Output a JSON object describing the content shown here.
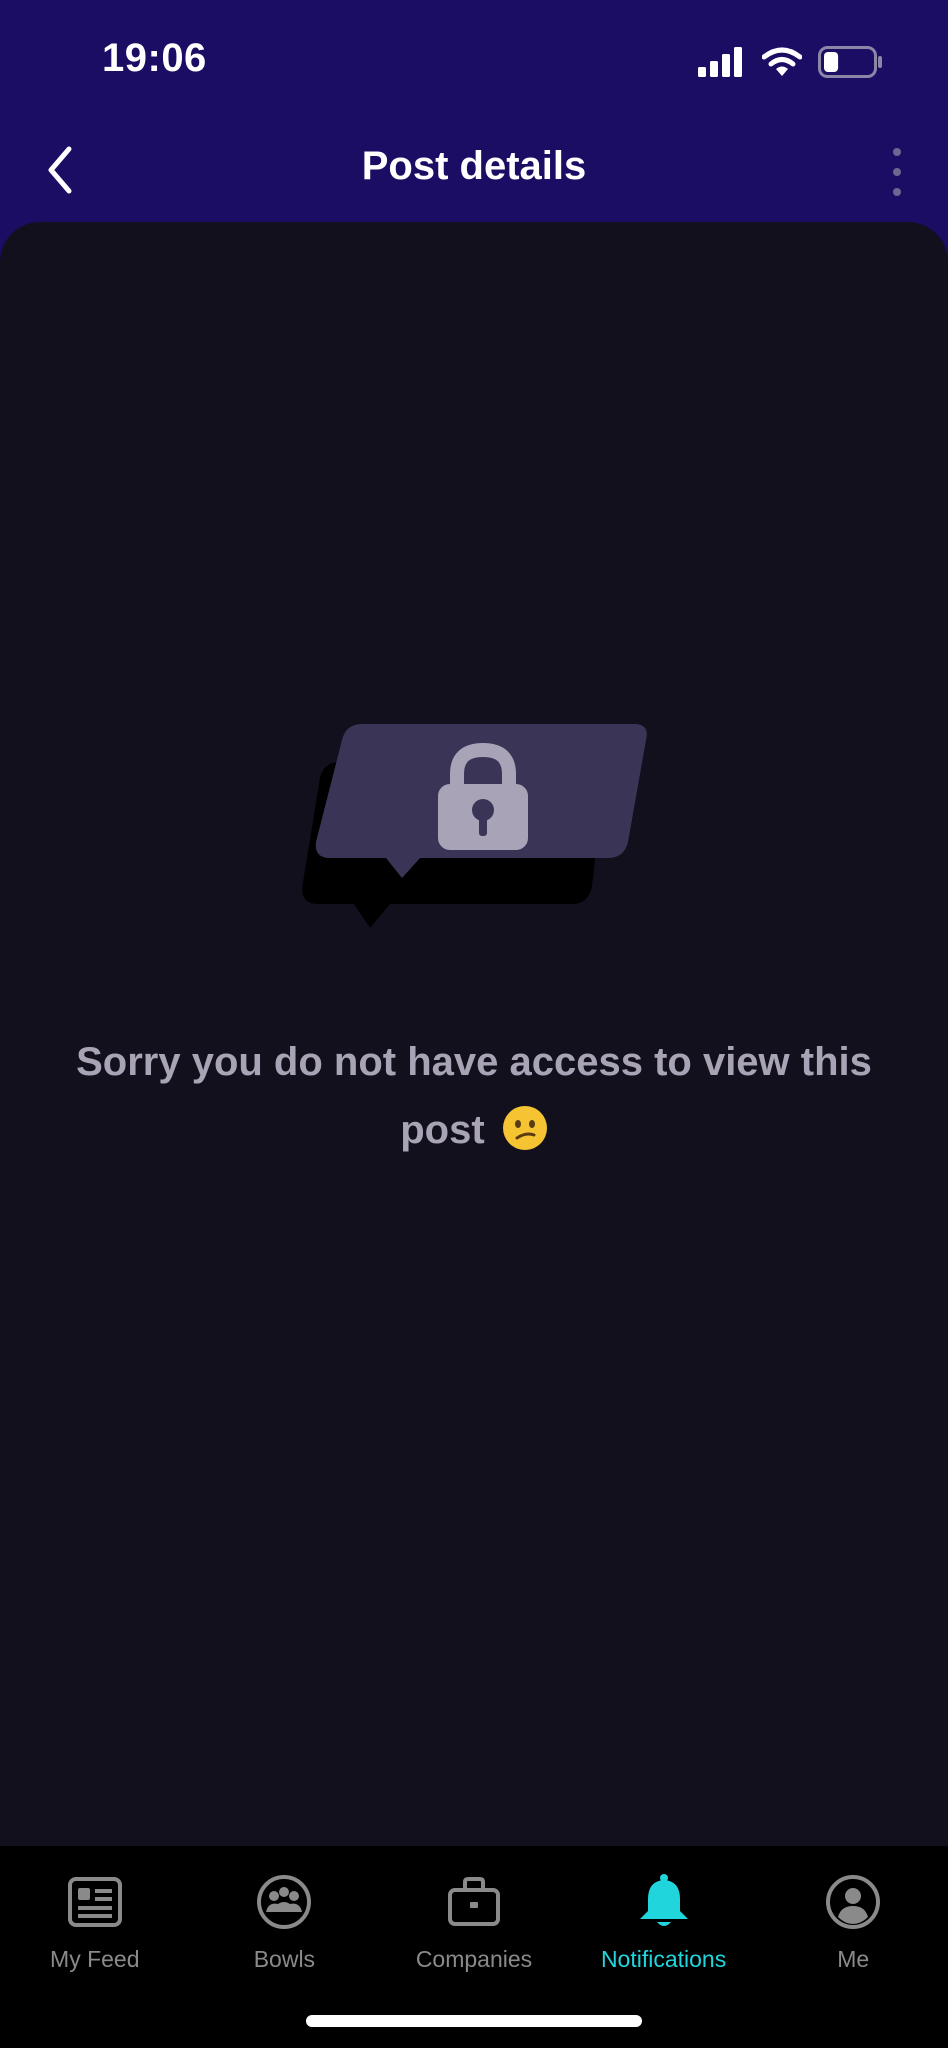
{
  "status_bar": {
    "time": "19:06",
    "battery_level": 0.3
  },
  "header": {
    "title": "Post details"
  },
  "content": {
    "message": "Sorry you do not have access to view this post"
  },
  "tabs": [
    {
      "label": "My Feed",
      "icon": "feed-icon",
      "active": false
    },
    {
      "label": "Bowls",
      "icon": "bowls-icon",
      "active": false
    },
    {
      "label": "Companies",
      "icon": "briefcase-icon",
      "active": false
    },
    {
      "label": "Notifications",
      "icon": "bell-icon",
      "active": true
    },
    {
      "label": "Me",
      "icon": "profile-icon",
      "active": false
    }
  ],
  "colors": {
    "header_bg": "#1b0d63",
    "content_bg": "#12101d",
    "accent": "#20d6dc",
    "inactive_tab": "#8a8a8a"
  }
}
